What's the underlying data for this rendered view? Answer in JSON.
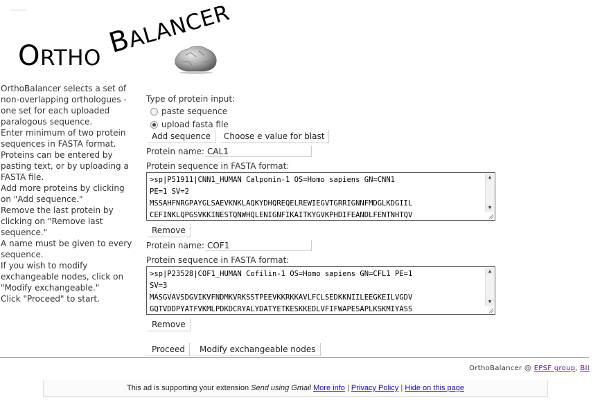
{
  "logo": {
    "part1_big": "O",
    "part1_rest": "RTHO",
    "part2_big": "B",
    "part2_rest": "ALANCER"
  },
  "sidebar": {
    "paragraphs": [
      "OrthoBalancer selects a set of non-overlapping orthologues - one set for each uploaded paralogous sequence.",
      "Enter minimum of two protein sequences in FASTA format. Proteins can be entered by pasting text, or by uploading a FASTA file.",
      "Add more proteins by clicking on \"Add sequence.\"",
      "Remove the last protein by clicking on \"Remove last sequence.\"",
      "A name must be given to every sequence.",
      "If you wish to modify exchangeable nodes, click on \"Modify exchangeable.\"",
      "Click \"Proceed\" to start."
    ]
  },
  "form": {
    "input_type_label": "Type of protein input:",
    "radio_paste": "paste sequence",
    "radio_upload": "upload fasta file",
    "selected_input": "upload fasta file",
    "add_sequence_label": "Add sequence",
    "evalue_label": "Choose e value for blast",
    "proteins": [
      {
        "name_label": "Protein name:",
        "name_value": "CAL1",
        "seq_label": "Protein sequence in FASTA format:",
        "seq_lines": [
          ">sp|P51911|CNN1_HUMAN Calponin-1 OS=Homo sapiens GN=CNN1",
          "PE=1 SV=2",
          "MSSAHFNRGPAYGLSAEVKNKLAQKYDHQREQELREWIEGVTGRRIGNNFMDGLKDGIIL",
          "CEFINKLQPGSVKKINESTQNWHQLENIGNFIKAITKYGVKPHDIFEANDLFENTNHTQV"
        ],
        "remove_label": "Remove"
      },
      {
        "name_label": "Protein name:",
        "name_value": "COF1",
        "seq_label": "Protein sequence in FASTA format:",
        "seq_lines": [
          ">sp|P23528|COF1_HUMAN Cofilin-1 OS=Homo sapiens GN=CFL1 PE=1",
          "SV=3",
          "MASGVAVSDGVIKVFNDMKVRKSSTPEEVKKRKKAVLFCLSEDKKNIILEEGKEILVGDV",
          "GQTVDDPYATFVKMLPDKDCRYALYDATYETKESKKEDLVFIFWAPESAPLKSKMIYASS"
        ],
        "remove_label": "Remove"
      }
    ],
    "proceed_label": "Proceed",
    "modify_label": "Modify exchangeable nodes"
  },
  "footer": {
    "prefix": "OrthoBalancer @ ",
    "link1": "EPSF group",
    "sep": ", ",
    "link2": "BII"
  },
  "adbar": {
    "text1": "This ad is supporting your extension ",
    "text_italic": "Send using Gmail",
    "link_more": "More info",
    "divider": " | ",
    "link_privacy": "Privacy Policy",
    "link_hide": "Hide on this page"
  }
}
